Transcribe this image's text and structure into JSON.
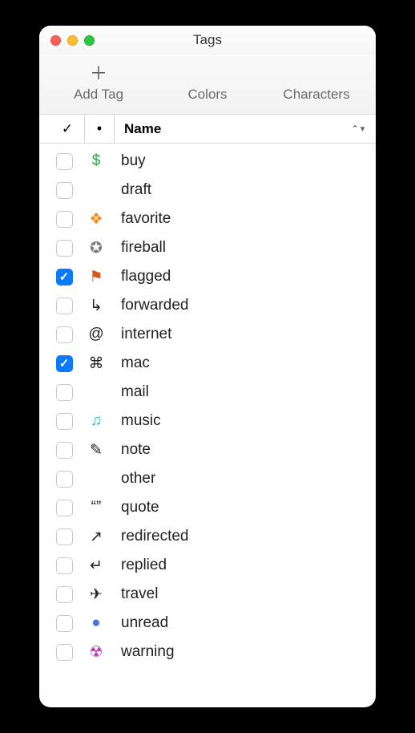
{
  "window": {
    "title": "Tags"
  },
  "toolbar": {
    "add": {
      "label": "Add Tag",
      "icon": "plus-icon"
    },
    "colors": {
      "label": "Colors",
      "icon": "palette-icon"
    },
    "chars": {
      "label": "Characters",
      "icon": "smiley-icon"
    }
  },
  "columns": {
    "check": "✓",
    "icon": "•",
    "name": "Name"
  },
  "tags": [
    {
      "checked": false,
      "icon": "$",
      "iconColor": "ic-green",
      "nameColor": "c-green",
      "name": "buy"
    },
    {
      "checked": false,
      "icon": "",
      "iconColor": "",
      "nameColor": "c-black",
      "name": "draft"
    },
    {
      "checked": false,
      "icon": "❖",
      "iconColor": "ic-orange",
      "nameColor": "c-orange",
      "name": "favorite"
    },
    {
      "checked": false,
      "icon": "✪",
      "iconColor": "ic-gray",
      "nameColor": "c-gray",
      "name": "fireball"
    },
    {
      "checked": true,
      "icon": "⚑",
      "iconColor": "ic-rust",
      "nameColor": "c-rust",
      "name": "flagged"
    },
    {
      "checked": false,
      "icon": "↳",
      "iconColor": "ic-black",
      "nameColor": "c-black",
      "name": "forwarded"
    },
    {
      "checked": false,
      "icon": "@",
      "iconColor": "ic-black",
      "nameColor": "c-black",
      "name": "internet"
    },
    {
      "checked": true,
      "icon": "⌘",
      "iconColor": "ic-black",
      "nameColor": "c-black",
      "name": "mac"
    },
    {
      "checked": false,
      "icon": "",
      "iconColor": "",
      "nameColor": "c-black",
      "name": "mail"
    },
    {
      "checked": false,
      "icon": "♫",
      "iconColor": "ic-teal",
      "nameColor": "c-teal",
      "name": "music"
    },
    {
      "checked": false,
      "icon": "✎",
      "iconColor": "ic-black",
      "nameColor": "c-black",
      "name": "note"
    },
    {
      "checked": false,
      "icon": "",
      "iconColor": "",
      "nameColor": "c-black",
      "name": "other"
    },
    {
      "checked": false,
      "icon": "“”",
      "iconColor": "ic-black",
      "nameColor": "c-black",
      "name": "quote"
    },
    {
      "checked": false,
      "icon": "↗",
      "iconColor": "ic-black",
      "nameColor": "c-black",
      "name": "redirected"
    },
    {
      "checked": false,
      "icon": "↵",
      "iconColor": "ic-black",
      "nameColor": "c-black",
      "name": "replied"
    },
    {
      "checked": false,
      "icon": "✈",
      "iconColor": "ic-black",
      "nameColor": "c-black",
      "name": "travel"
    },
    {
      "checked": false,
      "icon": "●",
      "iconColor": "ic-blue",
      "nameColor": "c-blue",
      "name": "unread"
    },
    {
      "checked": false,
      "icon": "☢",
      "iconColor": "ic-purple",
      "nameColor": "c-purple",
      "name": "warning"
    }
  ]
}
